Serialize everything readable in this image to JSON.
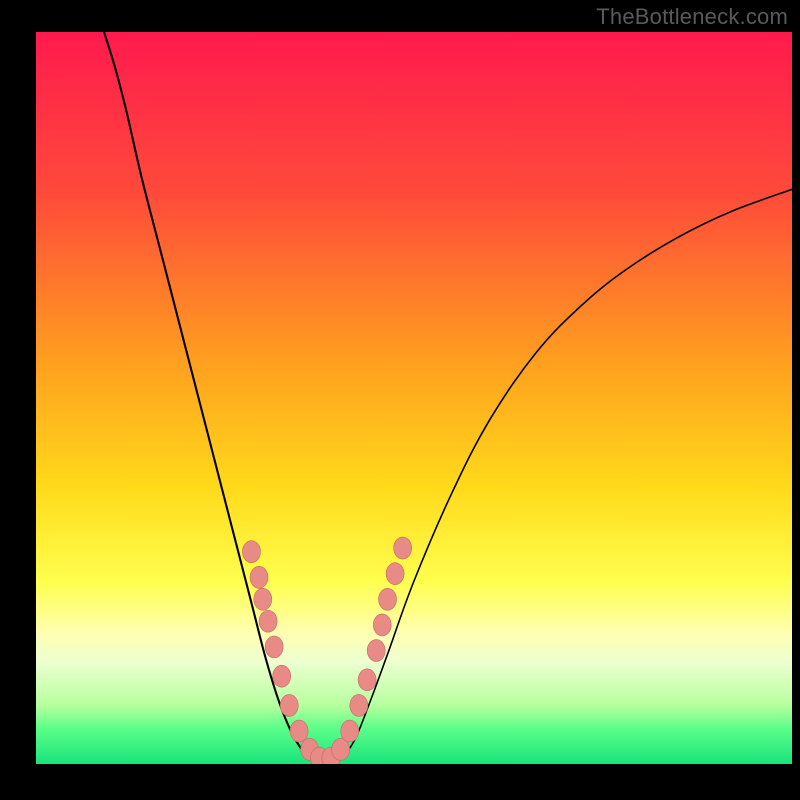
{
  "watermark": "TheBottleneck.com",
  "chart_data": {
    "type": "line",
    "title": "",
    "xlabel": "",
    "ylabel": "",
    "xlim": [
      0,
      100
    ],
    "ylim": [
      0,
      100
    ],
    "background": {
      "type": "vertical-gradient",
      "stops": [
        {
          "offset": 0.0,
          "color": "#ff1a4e"
        },
        {
          "offset": 0.22,
          "color": "#ff4a3a"
        },
        {
          "offset": 0.45,
          "color": "#ff9f1f"
        },
        {
          "offset": 0.62,
          "color": "#ffd91a"
        },
        {
          "offset": 0.75,
          "color": "#ffff4d"
        },
        {
          "offset": 0.82,
          "color": "#ffffb0"
        },
        {
          "offset": 0.86,
          "color": "#eeffd0"
        },
        {
          "offset": 0.92,
          "color": "#b6ff9e"
        },
        {
          "offset": 0.95,
          "color": "#5eff8a"
        },
        {
          "offset": 1.0,
          "color": "#18e47a"
        }
      ]
    },
    "series": [
      {
        "name": "left-branch",
        "stroke": "#000000",
        "stroke_width": 2.1,
        "points": [
          {
            "x": 9.0,
            "y": 100.0
          },
          {
            "x": 10.5,
            "y": 95.0
          },
          {
            "x": 12.0,
            "y": 89.0
          },
          {
            "x": 14.0,
            "y": 80.0
          },
          {
            "x": 16.5,
            "y": 70.0
          },
          {
            "x": 19.0,
            "y": 60.0
          },
          {
            "x": 21.5,
            "y": 50.0
          },
          {
            "x": 24.0,
            "y": 40.0
          },
          {
            "x": 26.5,
            "y": 30.0
          },
          {
            "x": 28.5,
            "y": 22.0
          },
          {
            "x": 30.5,
            "y": 14.0
          },
          {
            "x": 32.5,
            "y": 7.5
          },
          {
            "x": 34.5,
            "y": 3.0
          },
          {
            "x": 36.5,
            "y": 0.6
          },
          {
            "x": 38.5,
            "y": 0.0
          }
        ]
      },
      {
        "name": "right-branch",
        "stroke": "#000000",
        "stroke_width": 1.6,
        "points": [
          {
            "x": 38.5,
            "y": 0.0
          },
          {
            "x": 40.0,
            "y": 0.5
          },
          {
            "x": 42.0,
            "y": 3.0
          },
          {
            "x": 44.0,
            "y": 8.0
          },
          {
            "x": 46.5,
            "y": 15.0
          },
          {
            "x": 50.0,
            "y": 25.0
          },
          {
            "x": 55.0,
            "y": 37.0
          },
          {
            "x": 60.0,
            "y": 47.0
          },
          {
            "x": 66.0,
            "y": 56.0
          },
          {
            "x": 72.0,
            "y": 62.5
          },
          {
            "x": 78.0,
            "y": 67.5
          },
          {
            "x": 85.0,
            "y": 72.0
          },
          {
            "x": 92.0,
            "y": 75.5
          },
          {
            "x": 100.0,
            "y": 78.5
          }
        ]
      }
    ],
    "markers": {
      "fill": "#e88a85",
      "stroke": "#c56a64",
      "rx": 9,
      "ry": 11,
      "points": [
        {
          "x": 28.5,
          "y": 29.0
        },
        {
          "x": 29.5,
          "y": 25.5
        },
        {
          "x": 30.0,
          "y": 22.5
        },
        {
          "x": 30.7,
          "y": 19.5
        },
        {
          "x": 31.5,
          "y": 16.0
        },
        {
          "x": 32.5,
          "y": 12.0
        },
        {
          "x": 33.5,
          "y": 8.0
        },
        {
          "x": 34.8,
          "y": 4.5
        },
        {
          "x": 36.2,
          "y": 2.0
        },
        {
          "x": 37.5,
          "y": 0.8
        },
        {
          "x": 39.0,
          "y": 0.8
        },
        {
          "x": 40.3,
          "y": 2.0
        },
        {
          "x": 41.5,
          "y": 4.5
        },
        {
          "x": 42.7,
          "y": 8.0
        },
        {
          "x": 43.8,
          "y": 11.5
        },
        {
          "x": 45.0,
          "y": 15.5
        },
        {
          "x": 45.8,
          "y": 19.0
        },
        {
          "x": 46.5,
          "y": 22.5
        },
        {
          "x": 47.5,
          "y": 26.0
        },
        {
          "x": 48.5,
          "y": 29.5
        }
      ]
    },
    "frame": {
      "left_margin": 36,
      "right_margin": 8,
      "top_margin": 32,
      "bottom_margin": 36,
      "border_color": "#000000"
    }
  }
}
